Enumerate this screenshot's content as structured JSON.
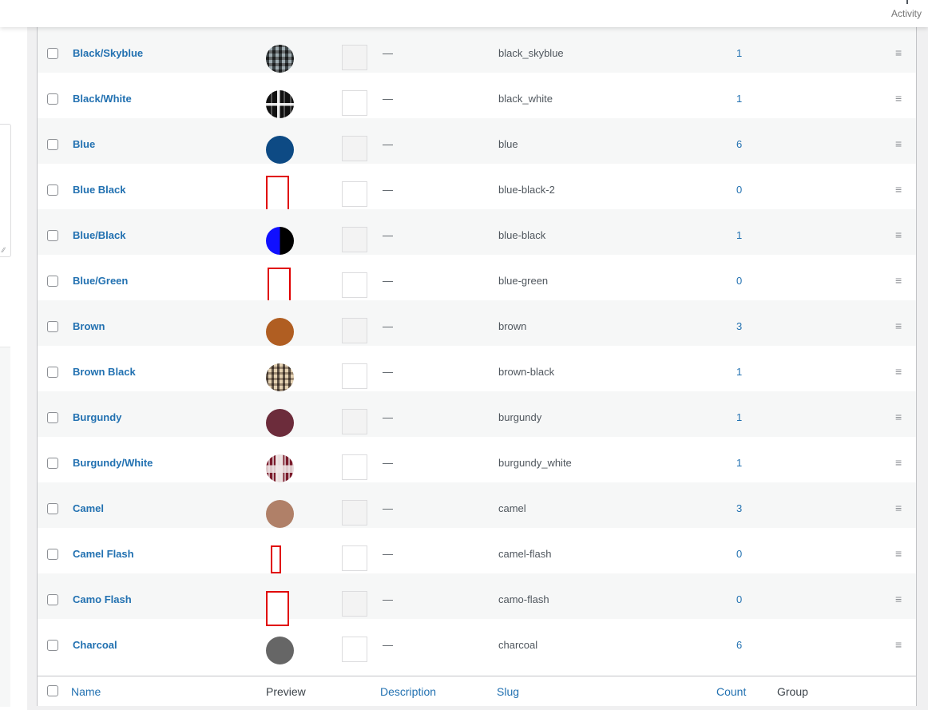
{
  "topbar": {
    "activity_label": "Activity"
  },
  "table": {
    "footer": {
      "name": "Name",
      "preview": "Preview",
      "description": "Description",
      "slug": "Slug",
      "count": "Count",
      "group": "Group"
    },
    "rows": [
      {
        "name": "Black/Skyblue",
        "description": "—",
        "slug": "black_skyblue",
        "count": "1",
        "preview": "pattern-black-skyblue"
      },
      {
        "name": "Black/White",
        "description": "—",
        "slug": "black_white",
        "count": "1",
        "preview": "pattern-black-white"
      },
      {
        "name": "Blue",
        "description": "—",
        "slug": "blue",
        "count": "6",
        "preview": "#0d4a84"
      },
      {
        "name": "Blue Black",
        "description": "—",
        "slug": "blue-black-2",
        "count": "0",
        "preview": "missing-image"
      },
      {
        "name": "Blue/Black",
        "description": "—",
        "slug": "blue-black",
        "count": "1",
        "preview": "split-blue-black"
      },
      {
        "name": "Blue/Green",
        "description": "—",
        "slug": "blue-green",
        "count": "0",
        "preview": "missing-image"
      },
      {
        "name": "Brown",
        "description": "—",
        "slug": "brown",
        "count": "3",
        "preview": "#b05e22"
      },
      {
        "name": "Brown Black",
        "description": "—",
        "slug": "brown-black",
        "count": "1",
        "preview": "pattern-brown-black"
      },
      {
        "name": "Burgundy",
        "description": "—",
        "slug": "burgundy",
        "count": "1",
        "preview": "#6c2c3b"
      },
      {
        "name": "Burgundy/White",
        "description": "—",
        "slug": "burgundy_white",
        "count": "1",
        "preview": "pattern-burgundy-white"
      },
      {
        "name": "Camel",
        "description": "—",
        "slug": "camel",
        "count": "3",
        "preview": "#b08068"
      },
      {
        "name": "Camel Flash",
        "description": "—",
        "slug": "camel-flash",
        "count": "0",
        "preview": "missing-image"
      },
      {
        "name": "Camo Flash",
        "description": "—",
        "slug": "camo-flash",
        "count": "0",
        "preview": "missing-image"
      },
      {
        "name": "Charcoal",
        "description": "—",
        "slug": "charcoal",
        "count": "6",
        "preview": "#666666"
      }
    ]
  },
  "colors": {
    "link": "#2271b1",
    "missing_image_border": "#e00000"
  },
  "icons": {
    "row_handle": "drag-handle-icon",
    "missing_preview": "broken-image-icon"
  }
}
